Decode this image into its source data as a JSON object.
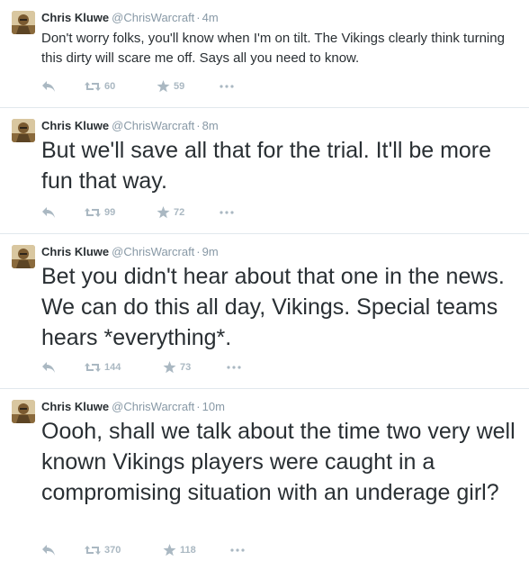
{
  "tweets": [
    {
      "name": "Chris Kluwe",
      "handle": "@ChrisWarcraft",
      "separator": "·",
      "time": "4m",
      "text": "Don't worry folks, you'll know when I'm on tilt. The Vikings clearly think turning this dirty will scare me off. Says all you need to know.",
      "retweets": "60",
      "favorites": "59",
      "icons": {
        "reply": "reply-icon",
        "retweet": "retweet-icon",
        "favorite": "star-icon",
        "more": "more-icon"
      }
    },
    {
      "name": "Chris Kluwe",
      "handle": "@ChrisWarcraft",
      "separator": "·",
      "time": "8m",
      "text": "But we'll save all that for the trial. It'll be more fun that way.",
      "retweets": "99",
      "favorites": "72",
      "icons": {
        "reply": "reply-icon",
        "retweet": "retweet-icon",
        "favorite": "star-icon",
        "more": "more-icon"
      }
    },
    {
      "name": "Chris Kluwe",
      "handle": "@ChrisWarcraft",
      "separator": "·",
      "time": "9m",
      "text": "Bet you didn't hear about that one in the news. We can do this all day, Vikings. Special teams hears *everything*.",
      "retweets": "144",
      "favorites": "73",
      "icons": {
        "reply": "reply-icon",
        "retweet": "retweet-icon",
        "favorite": "star-icon",
        "more": "more-icon"
      }
    },
    {
      "name": "Chris Kluwe",
      "handle": "@ChrisWarcraft",
      "separator": "·",
      "time": "10m",
      "text": "Oooh, shall we talk about the time two very well known Vikings players were caught in a compromising situation with an underage girl?",
      "retweets": "370",
      "favorites": "118",
      "icons": {
        "reply": "reply-icon",
        "retweet": "retweet-icon",
        "favorite": "star-icon",
        "more": "more-icon"
      }
    }
  ],
  "colors": {
    "text": "#292f33",
    "meta": "#8899a6",
    "action_icons": "#aab8c2",
    "divider": "#e1e8ed"
  }
}
